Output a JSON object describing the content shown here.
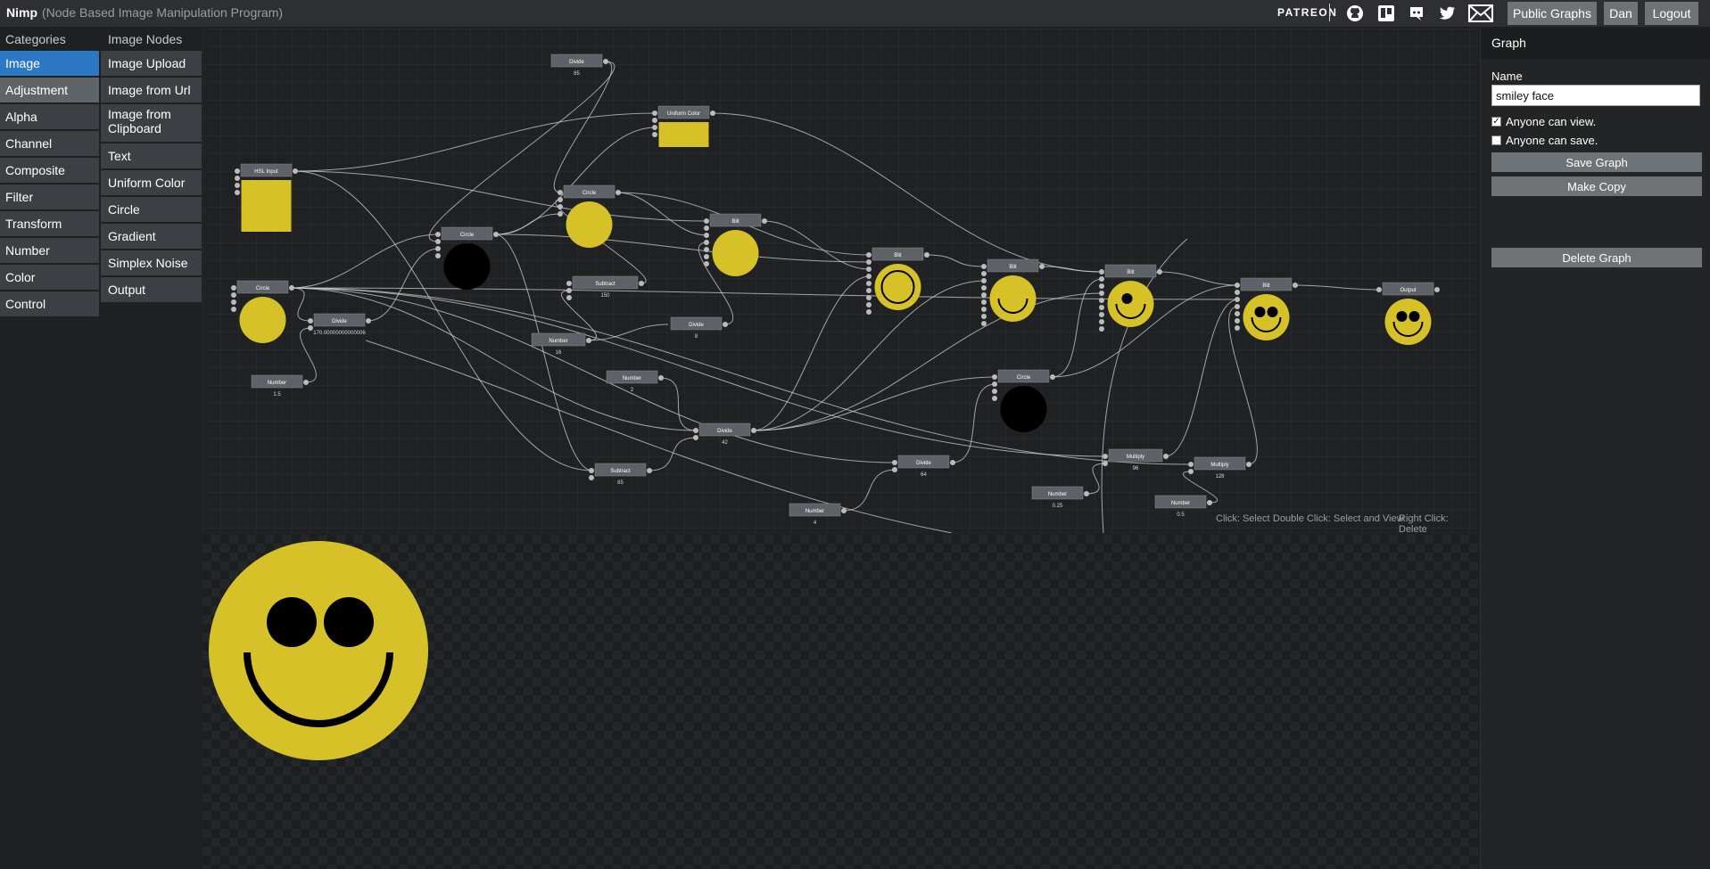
{
  "topbar": {
    "app_name": "Nimp",
    "app_subtitle": "(Node Based Image Manipulation Program)",
    "patreon_label": "PATREON",
    "icons": [
      "github-icon",
      "trello-icon",
      "discord-icon",
      "twitter-icon",
      "mail-icon"
    ],
    "buttons": {
      "public_graphs": "Public Graphs",
      "user": "Dan",
      "logout": "Logout"
    }
  },
  "categories": {
    "header": "Categories",
    "items": [
      "Image",
      "Adjustment",
      "Alpha",
      "Channel",
      "Composite",
      "Filter",
      "Transform",
      "Number",
      "Color",
      "Control"
    ],
    "active": "Image"
  },
  "image_nodes": {
    "header": "Image Nodes",
    "items": [
      "Image Upload",
      "Image from Url",
      "Image from Clipboard",
      "Text",
      "Uniform Color",
      "Circle",
      "Gradient",
      "Simplex Noise",
      "Output"
    ]
  },
  "graph": {
    "nodes": [
      {
        "title": "HSL Input",
        "value": ""
      },
      {
        "title": "Circle",
        "value": ""
      },
      {
        "title": "Divide",
        "value": "170.00000000000006"
      },
      {
        "title": "Number",
        "value": "1.5"
      },
      {
        "title": "Divide",
        "value": "85"
      },
      {
        "title": "Circle",
        "value": ""
      },
      {
        "title": "Uniform Color",
        "value": ""
      },
      {
        "title": "Circle",
        "value": ""
      },
      {
        "title": "Subtract",
        "value": "150"
      },
      {
        "title": "Number",
        "value": "16"
      },
      {
        "title": "Number",
        "value": "2"
      },
      {
        "title": "Divide",
        "value": "8"
      },
      {
        "title": "Subtract",
        "value": "85"
      },
      {
        "title": "Blit",
        "value": ""
      },
      {
        "title": "Divide",
        "value": "42"
      },
      {
        "title": "Number",
        "value": "4"
      },
      {
        "title": "Blit",
        "value": ""
      },
      {
        "title": "Divide",
        "value": "64"
      },
      {
        "title": "Blit",
        "value": ""
      },
      {
        "title": "Circle",
        "value": ""
      },
      {
        "title": "Number",
        "value": "0.25"
      },
      {
        "title": "Blit",
        "value": ""
      },
      {
        "title": "Multiply",
        "value": "96"
      },
      {
        "title": "Blit",
        "value": ""
      },
      {
        "title": "Multiply",
        "value": "128"
      },
      {
        "title": "Number",
        "value": "0.5"
      },
      {
        "title": "Output",
        "value": ""
      }
    ],
    "hints": [
      "Click: Select",
      "Double Click: Select and View",
      "Right Click: Delete"
    ],
    "colors": {
      "yellow": "#d6c228",
      "node_bg": "#5d6268",
      "wire": "#d0d0d0"
    }
  },
  "sidebar": {
    "title": "Graph",
    "name_label": "Name",
    "name_value": "smiley face",
    "anyone_can_view": "Anyone can view.",
    "anyone_can_view_checked": true,
    "anyone_can_save": "Anyone can save.",
    "anyone_can_save_checked": false,
    "save_graph": "Save Graph",
    "make_copy": "Make Copy",
    "delete_graph": "Delete Graph"
  }
}
